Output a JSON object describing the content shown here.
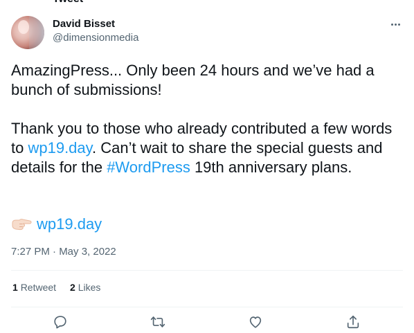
{
  "header_cut_text": "Tweet",
  "author": {
    "display_name": "David Bisset",
    "handle": "@dimensionmedia"
  },
  "tweet": {
    "para1": "AmazingPress... Only been 24 hours and we’ve had a bunch of submissions!",
    "para2_pre": "Thank you to those who already contributed a few words to ",
    "para2_link": "wp19.day",
    "para2_mid": ". Can’t wait to share the special guests and details for the ",
    "para2_hashtag": "#WordPress",
    "para2_post": " 19th anniversary plans.",
    "emoji_link": "wp19.day"
  },
  "timestamp": "7:27 PM · May 3, 2022",
  "stats": {
    "retweets_count": "1",
    "retweets_label": "Retweet",
    "likes_count": "2",
    "likes_label": "Likes"
  },
  "icons": {
    "more": "more-dots-icon",
    "reply": "reply-icon",
    "retweet": "retweet-icon",
    "like": "heart-icon",
    "share": "share-icon",
    "emoji": "backhand-index-pointing-right-icon"
  },
  "colors": {
    "link": "#1d9bf0",
    "text": "#0f1419",
    "secondary": "#536471",
    "divider": "#eff3f4"
  }
}
